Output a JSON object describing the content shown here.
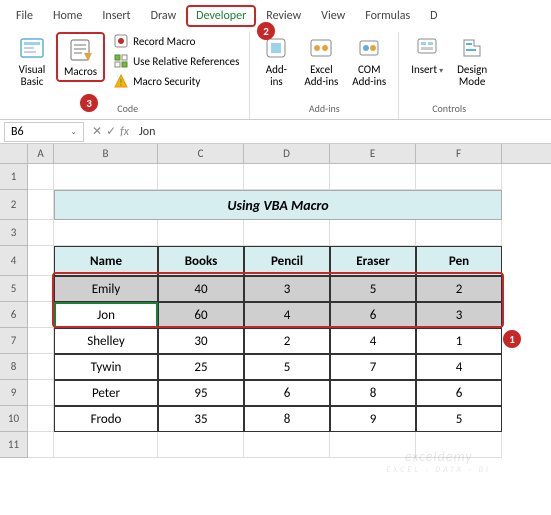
{
  "tabs": [
    "File",
    "Home",
    "Insert",
    "Draw",
    "Developer",
    "Review",
    "View",
    "Formulas",
    "D"
  ],
  "active_tab_index": 4,
  "ribbon": {
    "code": {
      "visual_basic": "Visual\nBasic",
      "macros": "Macros",
      "record_macro": "Record Macro",
      "use_relative": "Use Relative References",
      "macro_security": "Macro Security",
      "label": "Code"
    },
    "addins": {
      "addins": "Add-\nins",
      "excel_addins": "Excel\nAdd-ins",
      "com_addins": "COM\nAdd-ins",
      "label": "Add-ins"
    },
    "controls": {
      "insert": "Insert",
      "design_mode": "Design\nMode",
      "label": "Controls"
    }
  },
  "namebox": "B6",
  "formula": "Jon",
  "col_labels": [
    "A",
    "B",
    "C",
    "D",
    "E",
    "F"
  ],
  "row_labels": [
    "1",
    "2",
    "3",
    "4",
    "5",
    "6",
    "7",
    "8",
    "9",
    "10",
    "11"
  ],
  "title_cell": "Using VBA Macro",
  "headers": [
    "Name",
    "Books",
    "Pencil",
    "Eraser",
    "Pen"
  ],
  "rows": [
    {
      "name": "Emily",
      "books": "40",
      "pencil": "3",
      "eraser": "5",
      "pen": "2"
    },
    {
      "name": "Jon",
      "books": "60",
      "pencil": "4",
      "eraser": "6",
      "pen": "3"
    },
    {
      "name": "Shelley",
      "books": "30",
      "pencil": "2",
      "eraser": "4",
      "pen": "1"
    },
    {
      "name": "Tywin",
      "books": "25",
      "pencil": "5",
      "eraser": "7",
      "pen": "4"
    },
    {
      "name": "Peter",
      "books": "95",
      "pencil": "6",
      "eraser": "8",
      "pen": "6"
    },
    {
      "name": "Frodo",
      "books": "35",
      "pencil": "8",
      "eraser": "9",
      "pen": "5"
    }
  ],
  "callouts": {
    "1": "1",
    "2": "2",
    "3": "3"
  },
  "watermark": {
    "main": "exceldemy",
    "sub": "EXCEL · DATA · BI"
  },
  "chart_data": {
    "type": "table",
    "title": "Using VBA Macro",
    "columns": [
      "Name",
      "Books",
      "Pencil",
      "Eraser",
      "Pen"
    ],
    "rows": [
      [
        "Emily",
        40,
        3,
        5,
        2
      ],
      [
        "Jon",
        60,
        4,
        6,
        3
      ],
      [
        "Shelley",
        30,
        2,
        4,
        1
      ],
      [
        "Tywin",
        25,
        5,
        7,
        4
      ],
      [
        "Peter",
        95,
        6,
        8,
        6
      ],
      [
        "Frodo",
        35,
        8,
        9,
        5
      ]
    ]
  }
}
